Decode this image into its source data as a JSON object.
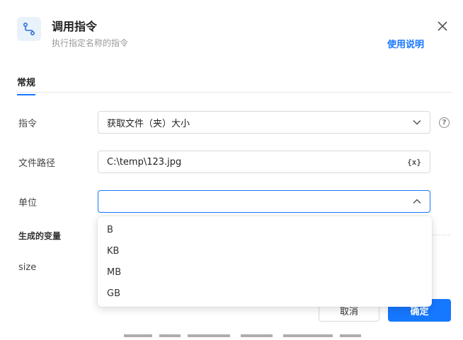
{
  "header": {
    "title": "调用指令",
    "subtitle": "执行指定名称的指令",
    "help_link": "使用说明"
  },
  "tabs": [
    {
      "label": "常规",
      "active": true
    }
  ],
  "form": {
    "command": {
      "label": "指令",
      "value": "获取文件（夹）大小"
    },
    "file_path": {
      "label": "文件路径",
      "value": "C:\\temp\\123.jpg",
      "var_button": "{x}"
    },
    "unit": {
      "label": "单位",
      "value": ""
    }
  },
  "section": {
    "title": "生成的变量"
  },
  "variable": {
    "label": "size"
  },
  "dropdown": {
    "options": [
      "B",
      "KB",
      "MB",
      "GB"
    ]
  },
  "footer": {
    "cancel_label": "取消",
    "ok_label": "确定"
  },
  "colors": {
    "accent": "#1677ff",
    "icon_bg": "#e9f1fb"
  }
}
